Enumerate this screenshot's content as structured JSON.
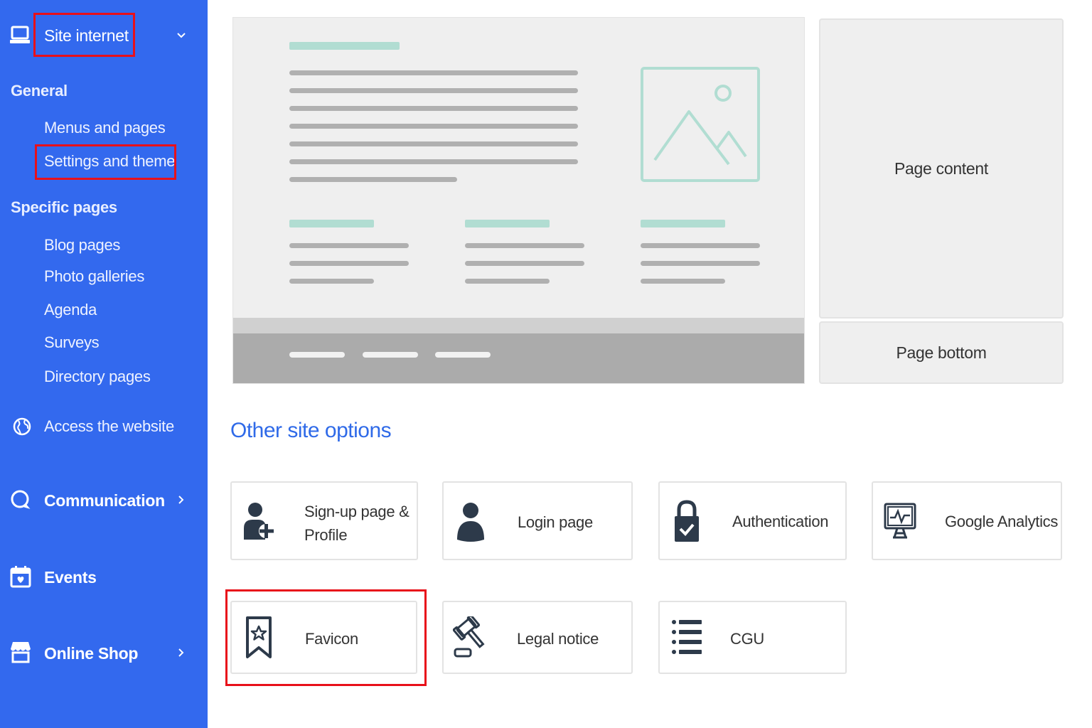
{
  "sidebar": {
    "site_internet": "Site internet",
    "general_heading": "General",
    "general_items": [
      "Menus and pages",
      "Settings and theme"
    ],
    "specific_heading": "Specific pages",
    "specific_items": [
      "Blog pages",
      "Photo galleries",
      "Agenda",
      "Surveys",
      "Directory pages"
    ],
    "access_website": "Access the website",
    "communication": "Communication",
    "events": "Events",
    "online_shop": "Online Shop"
  },
  "layout_zones": {
    "page_content": "Page content",
    "page_bottom": "Page bottom"
  },
  "options": {
    "title": "Other site options",
    "cards": [
      {
        "label_line1": "Sign-up page &",
        "label_line2": "Profile",
        "icon": "user-plus-icon"
      },
      {
        "label": "Login page",
        "icon": "user-icon"
      },
      {
        "label": "Authentication",
        "icon": "lock-check-icon"
      },
      {
        "label": "Google Analytics",
        "icon": "monitor-chart-icon"
      },
      {
        "label": "Favicon",
        "icon": "bookmark-star-icon"
      },
      {
        "label": "Legal notice",
        "icon": "gavel-icon"
      },
      {
        "label": "CGU",
        "icon": "list-icon"
      }
    ]
  },
  "colors": {
    "sidebar_bg": "#3369ee",
    "highlight_red": "#e8101a",
    "accent_teal": "#b1ddd2",
    "title_blue": "#2f6ae8"
  }
}
